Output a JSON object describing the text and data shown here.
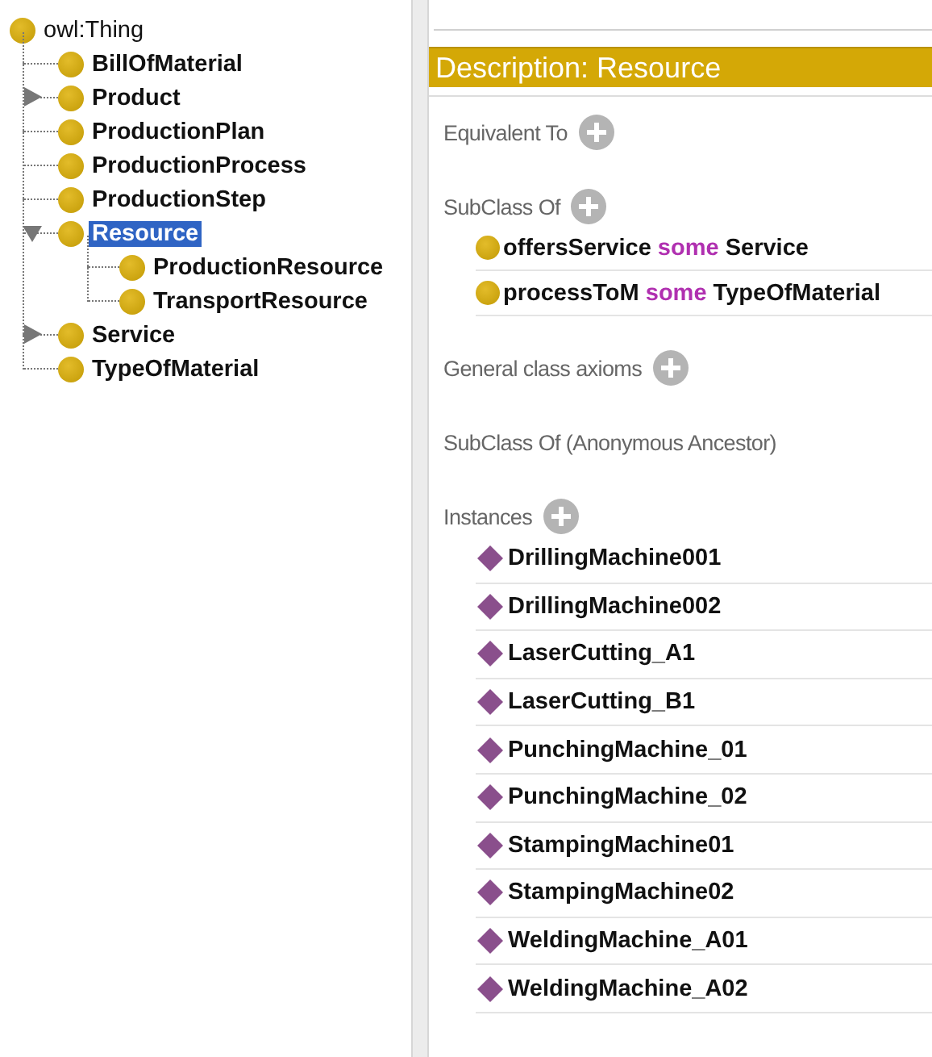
{
  "class_tree": {
    "root": {
      "label": "owl:Thing",
      "children": [
        {
          "label": "BillOfMaterial",
          "selected": false
        },
        {
          "label": "Product",
          "expanded": false,
          "selected": false
        },
        {
          "label": "ProductionPlan",
          "selected": false
        },
        {
          "label": "ProductionProcess",
          "selected": false
        },
        {
          "label": "ProductionStep",
          "selected": false
        },
        {
          "label": "Resource",
          "expanded": true,
          "selected": true,
          "children": [
            {
              "label": "ProductionResource",
              "selected": false
            },
            {
              "label": "TransportResource",
              "selected": false
            }
          ]
        },
        {
          "label": "Service",
          "expanded": false,
          "selected": false
        },
        {
          "label": "TypeOfMaterial",
          "selected": false
        }
      ]
    }
  },
  "description": {
    "title": "Description: Resource",
    "sections": [
      {
        "label": "Equivalent To",
        "addable": true
      },
      {
        "label": "SubClass Of",
        "addable": true,
        "kind": "axiom",
        "items": [
          {
            "property": "offersService",
            "keyword": "some",
            "filler": "Service"
          },
          {
            "property": "processToM",
            "keyword": "some",
            "filler": "TypeOfMaterial"
          }
        ]
      },
      {
        "label": "General class axioms",
        "addable": true
      },
      {
        "label": "SubClass Of (Anonymous Ancestor)",
        "addable": false
      },
      {
        "label": "Instances",
        "addable": true,
        "kind": "individual",
        "items": [
          {
            "name": "DrillingMachine001"
          },
          {
            "name": "DrillingMachine002"
          },
          {
            "name": "LaserCutting_A1"
          },
          {
            "name": "LaserCutting_B1"
          },
          {
            "name": "PunchingMachine_01"
          },
          {
            "name": "PunchingMachine_02"
          },
          {
            "name": "StampingMachine01"
          },
          {
            "name": "StampingMachine02"
          },
          {
            "name": "WeldingMachine_A01"
          },
          {
            "name": "WeldingMachine_A02"
          }
        ]
      }
    ]
  }
}
